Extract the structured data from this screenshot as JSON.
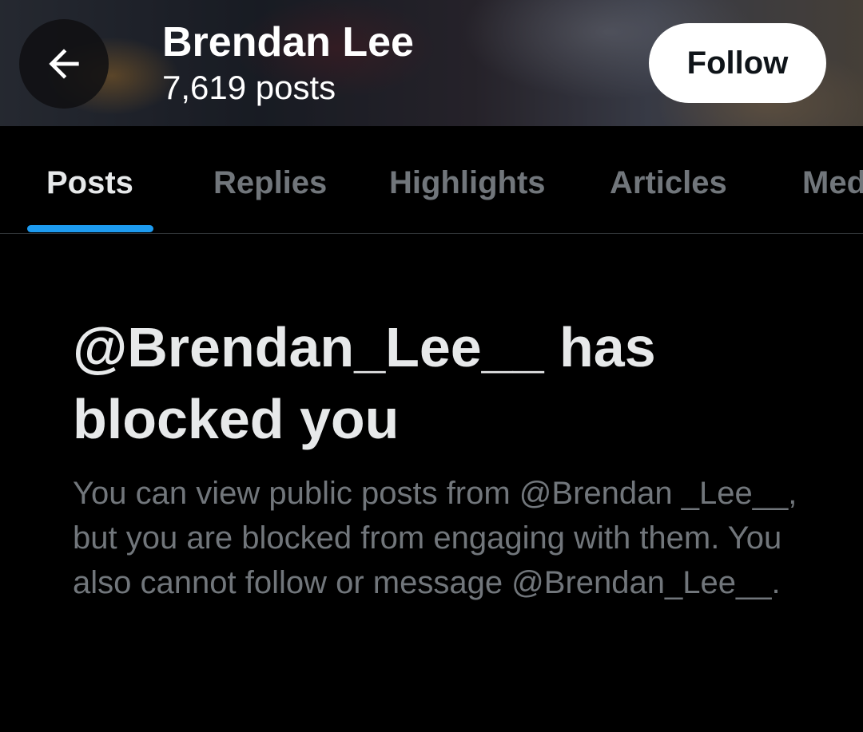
{
  "header": {
    "name": "Brendan Lee",
    "post_count": "7,619 posts",
    "back_icon": "arrow-left-icon",
    "follow_label": "Follow"
  },
  "tabs": [
    {
      "label": "Posts",
      "active": true
    },
    {
      "label": "Replies",
      "active": false
    },
    {
      "label": "Highlights",
      "active": false
    },
    {
      "label": "Articles",
      "active": false
    },
    {
      "label": "Media",
      "active": false
    }
  ],
  "blocked": {
    "title": "@Brendan_Lee__ has blocked you",
    "description": "You can view public posts from @Brendan _Lee__, but you are blocked from engaging with them. You also cannot follow or message @Brendan_Lee__."
  },
  "colors": {
    "background": "#000000",
    "accent": "#1d9bf0",
    "primary_text": "#e7e9ea",
    "secondary_text": "#71767b"
  }
}
